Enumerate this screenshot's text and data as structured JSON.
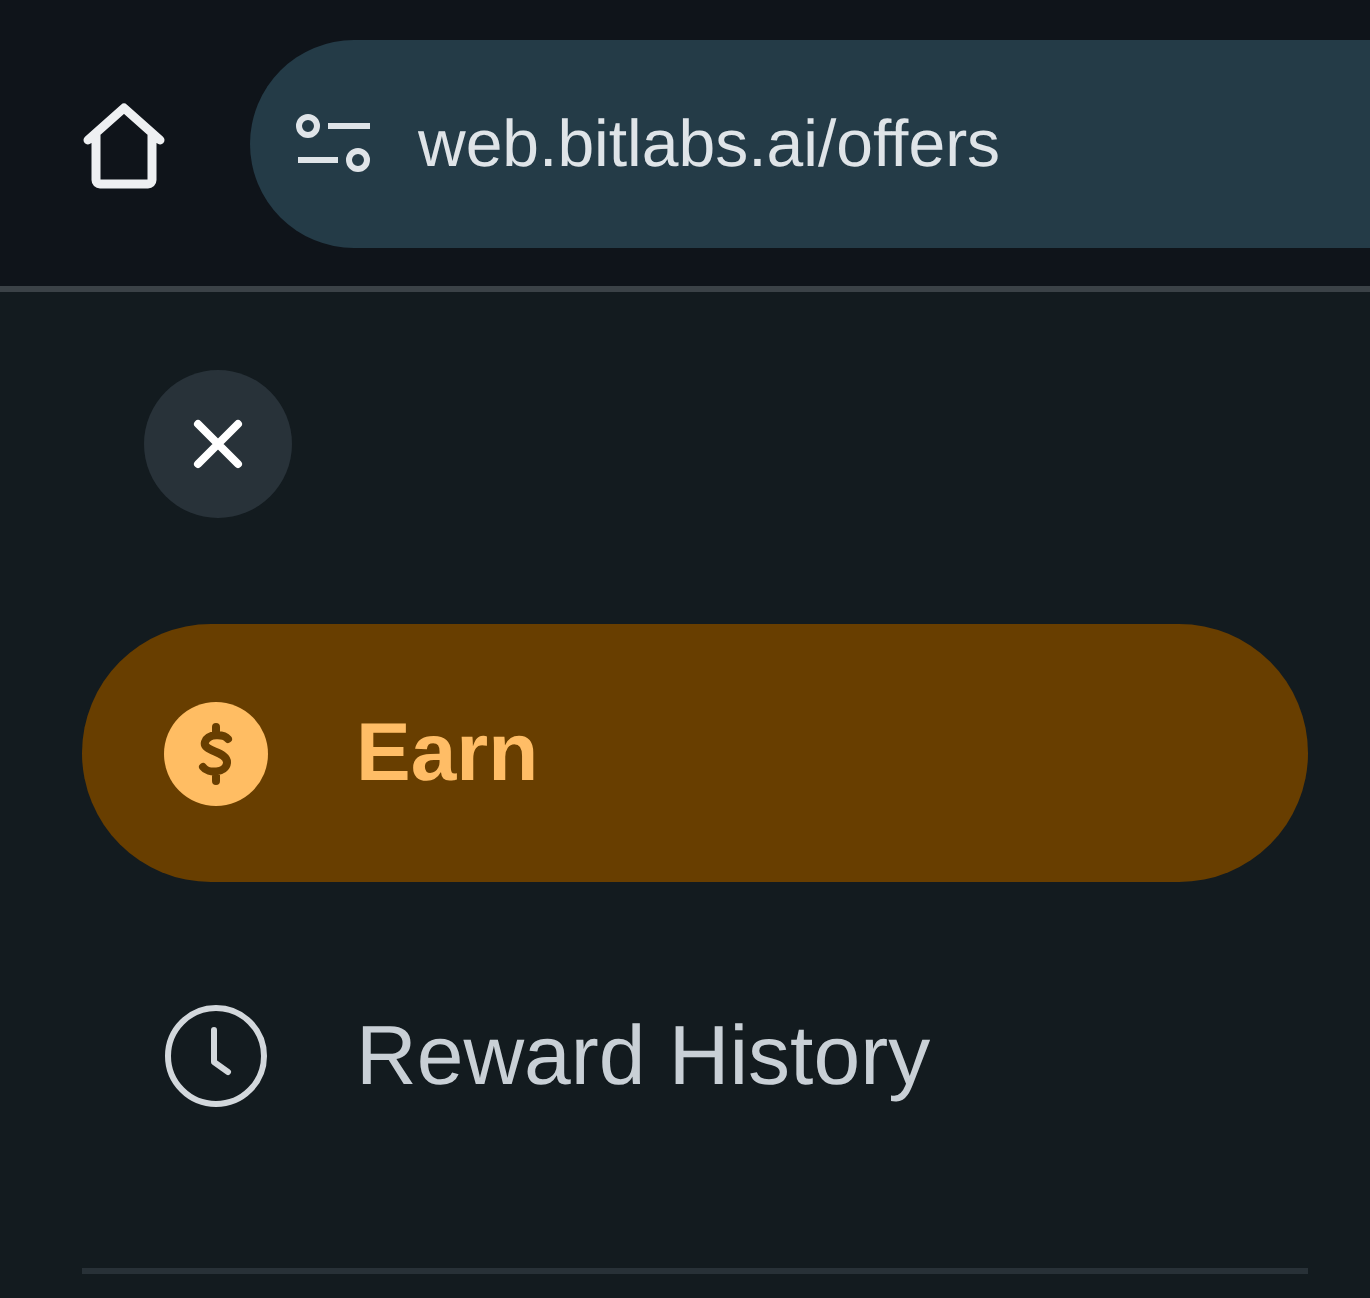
{
  "browser_bar": {
    "url": "web.bitlabs.ai/offers"
  },
  "menu": {
    "items": [
      {
        "label": "Earn",
        "kind": "coin",
        "selected": true
      },
      {
        "label": "Reward History",
        "kind": "clock",
        "selected": false
      }
    ]
  }
}
